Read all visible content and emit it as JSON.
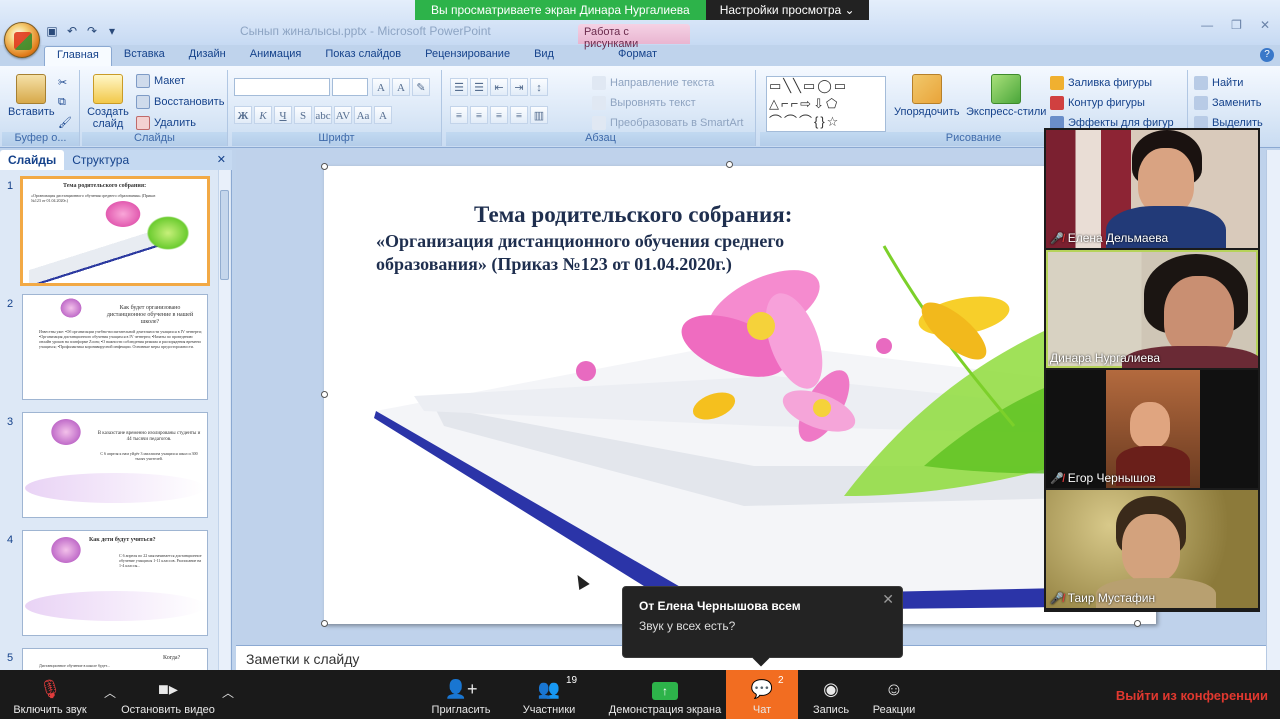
{
  "zoom": {
    "share_banner": "Вы просматриваете экран Динара Нургалиева",
    "view_options": "Настройки просмотра ⌄"
  },
  "ppt": {
    "doc_title": "Сынып жиналысы.pptx - Microsoft PowerPoint",
    "context_tab_header": "Работа с рисунками",
    "tabs": [
      "Главная",
      "Вставка",
      "Дизайн",
      "Анимация",
      "Показ слайдов",
      "Рецензирование",
      "Вид",
      "Формат"
    ],
    "groups": {
      "clipboard": {
        "label": "Буфер о...",
        "paste": "Вставить"
      },
      "slides": {
        "label": "Слайды",
        "new_slide": "Создать слайд",
        "layout": "Макет",
        "reset": "Восстановить",
        "delete": "Удалить"
      },
      "font": {
        "label": "Шрифт"
      },
      "paragraph": {
        "label": "Абзац",
        "text_direction": "Направление текста",
        "align_text": "Выровнять текст",
        "smartart": "Преобразовать в SmartArt"
      },
      "drawing": {
        "label": "Рисование",
        "arrange": "Упорядочить",
        "quick_styles": "Экспресс-стили",
        "shape_fill": "Заливка фигуры",
        "shape_outline": "Контур фигуры",
        "shape_effects": "Эффекты для фигур"
      },
      "editing": {
        "find": "Найти",
        "replace": "Заменить",
        "select": "Выделить"
      }
    },
    "panel_tabs": [
      "Слайды",
      "Структура"
    ],
    "thumbnails": [
      {
        "num": "1",
        "title": "Тема родительского собрания:",
        "body": "«Организация дистанционного обучения среднего образования» (Приказ №123 от 01.04.2020г.)"
      },
      {
        "num": "2",
        "title": "Как будет организовано дистанционное обучение в нашей школе?",
        "body": "Известны уже: •Об организации учебно-воспитательной деятельности учащихся в IV четверти; •Организация дистанционного обучения учащихся в IV четверти; •Начаты по проведению онлайн уроков на платформе Zoom; •О важности соблюдения режима и распорядения времени учащихся; •Профилактика коронавирусной инфекции. Основные меры предосторожности."
      },
      {
        "num": "3",
        "title": "В казахстане временно изолированы студенты и 44 тысячи педагогов.",
        "body": "С 6 апреля к нам уйдёт 3 миллиона учащихся школ и 300 тысяч учителей."
      },
      {
        "num": "4",
        "title": "Как дети будут учиться?",
        "body": "С 6 апреля по 22 мая начинается дистанционное обучение учащихся 1-11 классов. Расписание на 1-4 классы..."
      },
      {
        "num": "5",
        "title": "Когда?",
        "body": "Дистанционное обучение в школе будет..."
      }
    ],
    "slide": {
      "title": "Тема родительского собрания:",
      "subtitle": "«Организация дистанционного обучения среднего образования» (Приказ №123 от 01.04.2020г.)"
    },
    "notes_placeholder": "Заметки к слайду"
  },
  "participants": [
    {
      "name": "Елена Дельмаева",
      "muted": true
    },
    {
      "name": "Динара Нургалиева",
      "muted": false,
      "active": true
    },
    {
      "name": "Егор Чернышов",
      "muted": true
    },
    {
      "name": "Таир Мустафин",
      "muted": true
    }
  ],
  "chat_popup": {
    "from": "От Елена Чернышова всем",
    "message": "Звук у всех есть?"
  },
  "toolbar": {
    "unmute": "Включить звук",
    "start_video": "Остановить видео",
    "invite": "Пригласить",
    "participants": "Участники",
    "participants_count": "19",
    "share_screen": "Демонстрация экрана",
    "chat": "Чат",
    "chat_count": "2",
    "record": "Запись",
    "reactions": "Реакции",
    "leave": "Выйти из конференции"
  },
  "colors": {
    "zoom_green": "#2db34a",
    "zoom_orange": "#f26d21",
    "leave_red": "#e0382f",
    "ppt_blue": "#15428b"
  }
}
